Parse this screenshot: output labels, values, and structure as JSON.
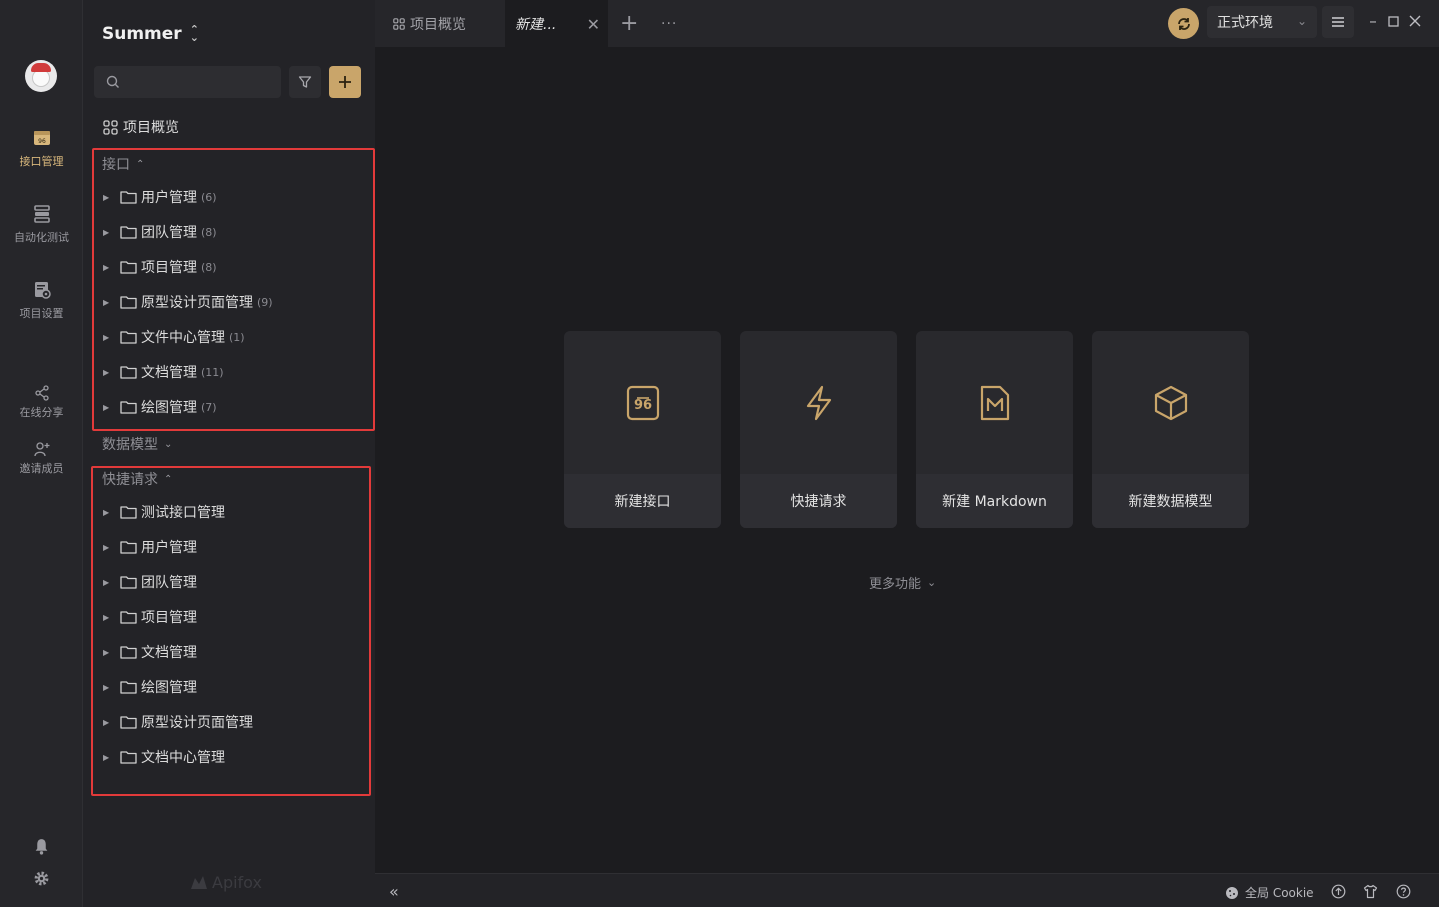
{
  "window": {
    "title": "Apifox"
  },
  "rail": {
    "items": [
      {
        "label": "接口管理",
        "icon": "api-folder-icon",
        "active": true
      },
      {
        "label": "自动化测试",
        "icon": "server-stack-icon",
        "active": false
      },
      {
        "label": "项目设置",
        "icon": "settings-doc-icon",
        "active": false
      },
      {
        "label": "在线分享",
        "icon": "share-icon",
        "active": false
      },
      {
        "label": "邀请成员",
        "icon": "add-user-icon",
        "active": false
      }
    ],
    "bottom": [
      "bell-icon",
      "gear-icon"
    ]
  },
  "sidebar": {
    "project_name": "Summer",
    "search": {
      "placeholder": "",
      "value": ""
    },
    "overview_label": "项目概览",
    "interface_section": {
      "label": "接口",
      "folders": [
        {
          "name": "用户管理",
          "count": "(6)"
        },
        {
          "name": "团队管理",
          "count": "(8)"
        },
        {
          "name": "项目管理",
          "count": "(8)"
        },
        {
          "name": "原型设计页面管理",
          "count": "(9)"
        },
        {
          "name": "文件中心管理",
          "count": "(1)"
        },
        {
          "name": "文档管理",
          "count": "(11)"
        },
        {
          "name": "绘图管理",
          "count": "(7)"
        }
      ]
    },
    "data_model_section": {
      "label": "数据模型"
    },
    "quick_request_section": {
      "label": "快捷请求",
      "folders": [
        {
          "name": "测试接口管理"
        },
        {
          "name": "用户管理"
        },
        {
          "name": "团队管理"
        },
        {
          "name": "项目管理"
        },
        {
          "name": "文档管理"
        },
        {
          "name": "绘图管理"
        },
        {
          "name": "原型设计页面管理"
        },
        {
          "name": "文档中心管理"
        }
      ]
    },
    "brand": "Apifox"
  },
  "tabs": {
    "overview_label": "项目概览",
    "active_label": "新建..."
  },
  "topbar": {
    "environment": "正式环境"
  },
  "main": {
    "cards": [
      {
        "label": "新建接口",
        "icon": "api-icon"
      },
      {
        "label": "快捷请求",
        "icon": "lightning-icon"
      },
      {
        "label": "新建 Markdown",
        "icon": "markdown-file-icon"
      },
      {
        "label": "新建数据模型",
        "icon": "cube-icon"
      }
    ],
    "more_label": "更多功能"
  },
  "footer": {
    "cookie_label": "全局 Cookie"
  },
  "colors": {
    "accent": "#c9a56a",
    "highlight_box": "#e23a3a",
    "background": "#1c1c1f"
  }
}
